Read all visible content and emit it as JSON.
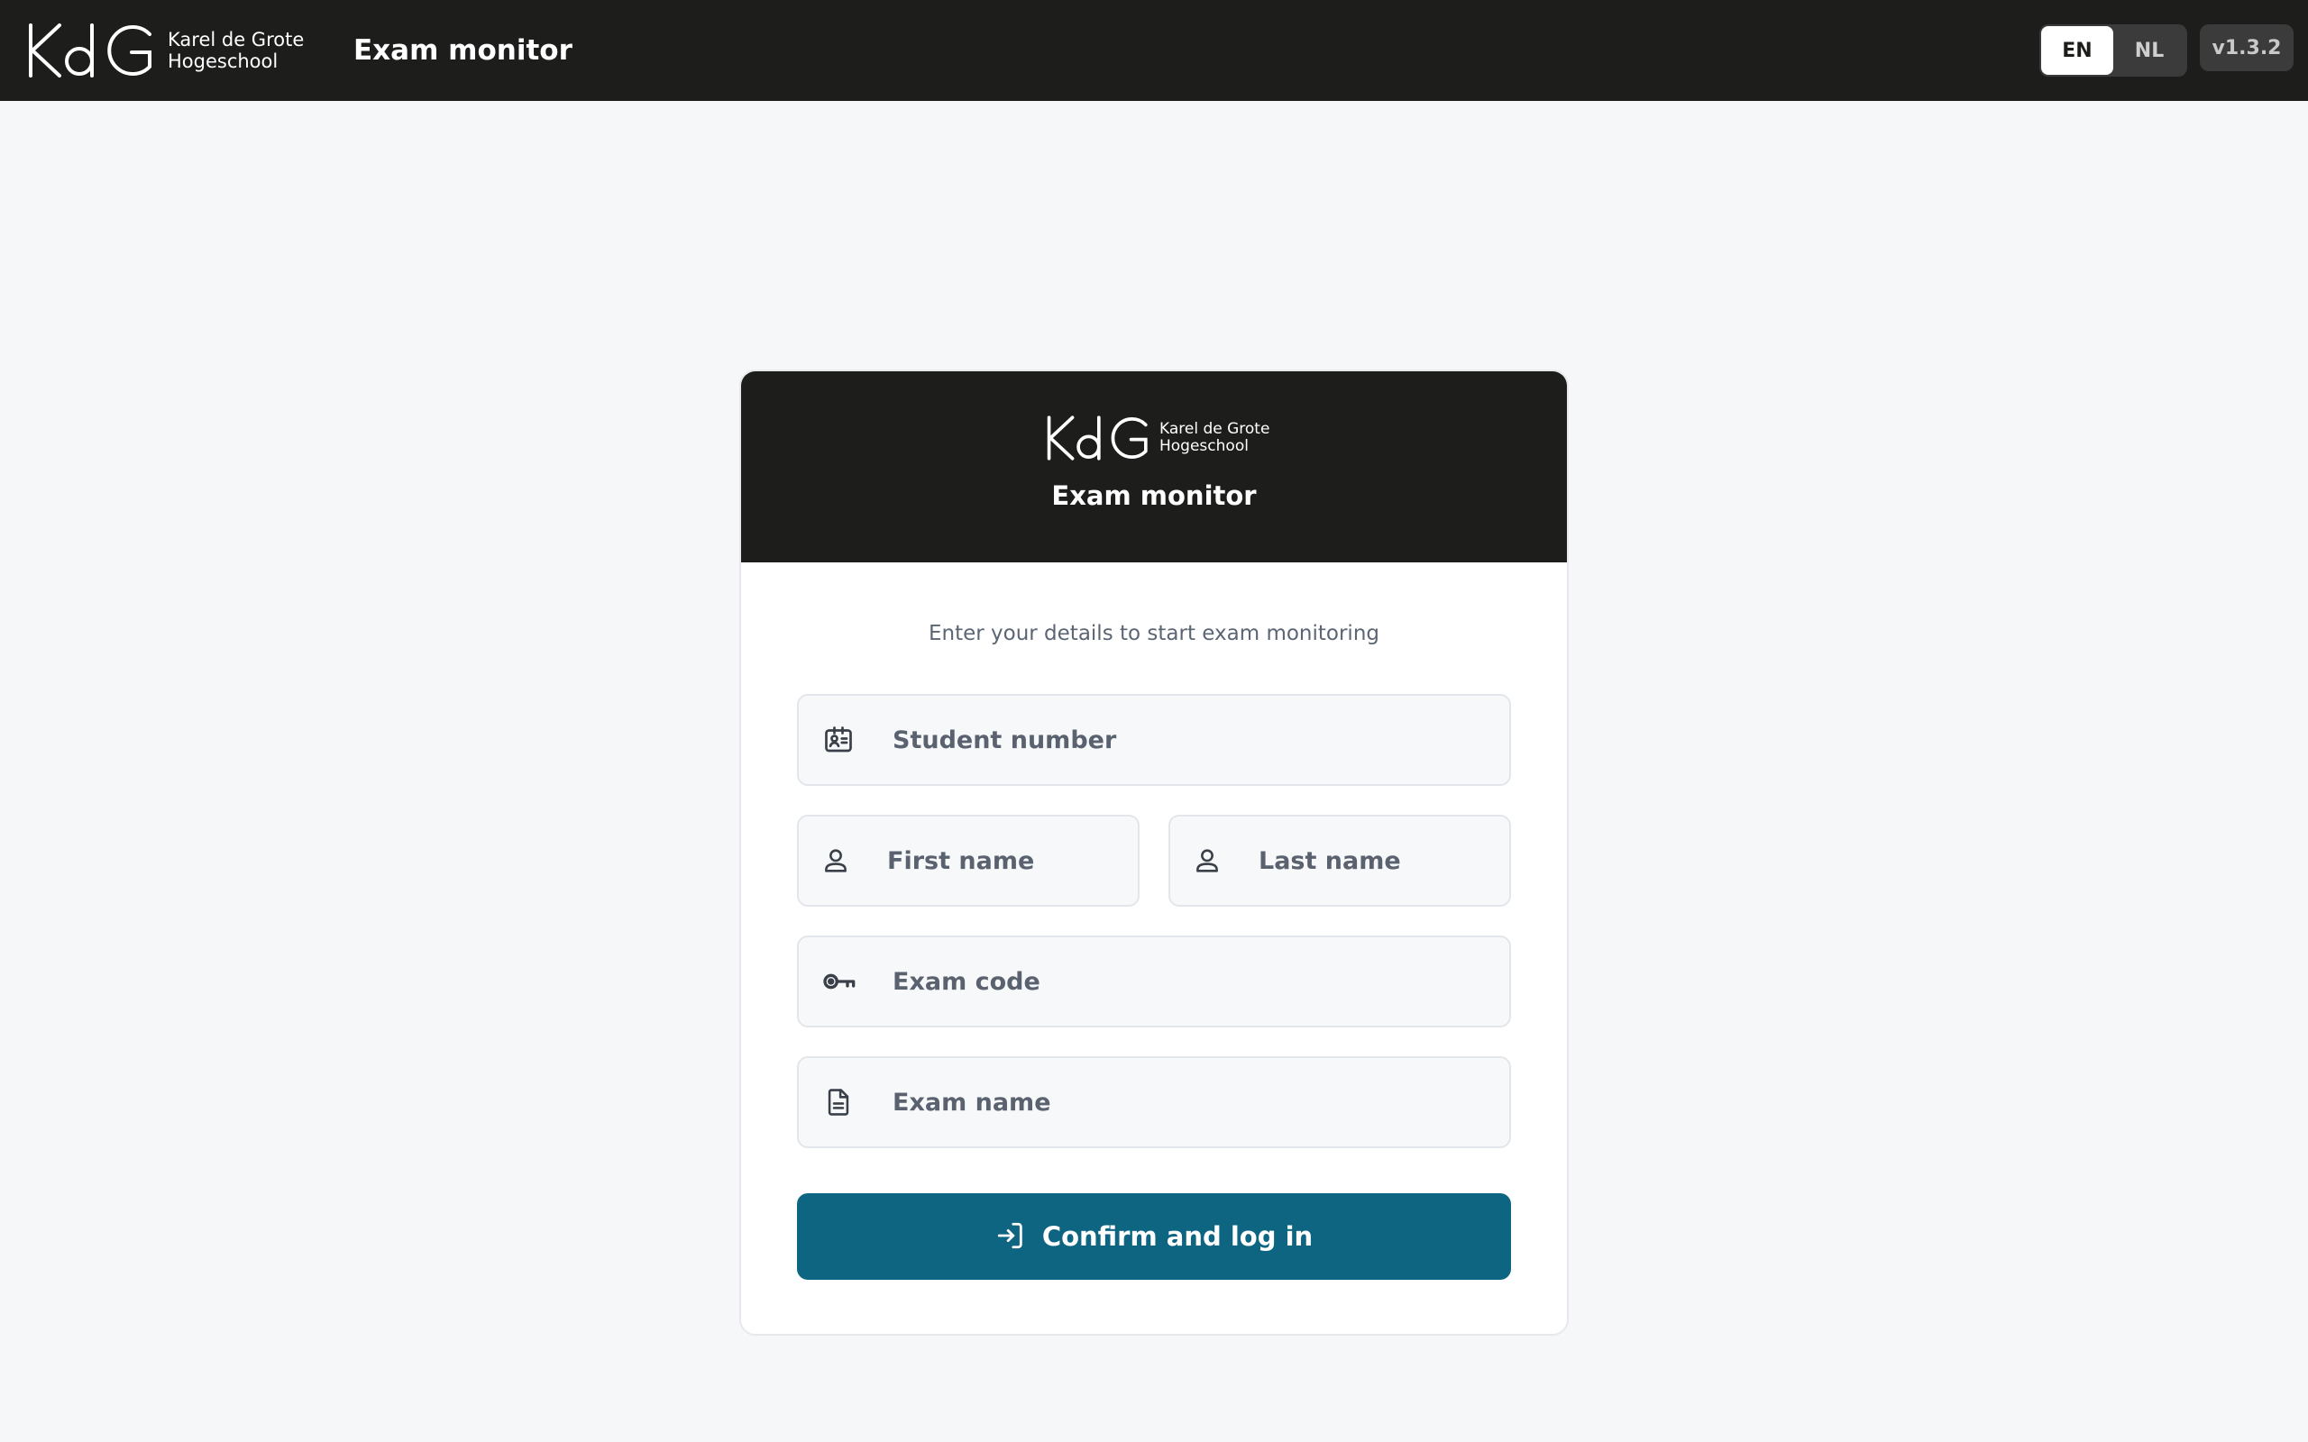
{
  "header": {
    "brand": {
      "mark": "KdG",
      "line1": "Karel de Grote",
      "line2": "Hogeschool"
    },
    "app_title": "Exam monitor",
    "languages": [
      {
        "code": "EN",
        "active": true
      },
      {
        "code": "NL",
        "active": false
      }
    ],
    "version": "v1.3.2"
  },
  "card": {
    "brand": {
      "mark": "KdG",
      "line1": "Karel de Grote",
      "line2": "Hogeschool"
    },
    "title": "Exam monitor",
    "subtitle": "Enter your details to start exam monitoring",
    "fields": {
      "student_number": {
        "placeholder": "Student number",
        "value": "",
        "icon": "id-card-icon"
      },
      "first_name": {
        "placeholder": "First name",
        "value": "",
        "icon": "user-icon"
      },
      "last_name": {
        "placeholder": "Last name",
        "value": "",
        "icon": "user-icon"
      },
      "exam_code": {
        "placeholder": "Exam code",
        "value": "",
        "icon": "key-icon"
      },
      "exam_name": {
        "placeholder": "Exam name",
        "value": "",
        "icon": "document-icon"
      }
    },
    "submit": {
      "label": "Confirm and log in",
      "icon": "login-icon"
    }
  },
  "colors": {
    "header_bg": "#1d1d1c",
    "page_bg": "#f6f7f9",
    "primary": "#0e6582",
    "muted_text": "#5b6574"
  }
}
